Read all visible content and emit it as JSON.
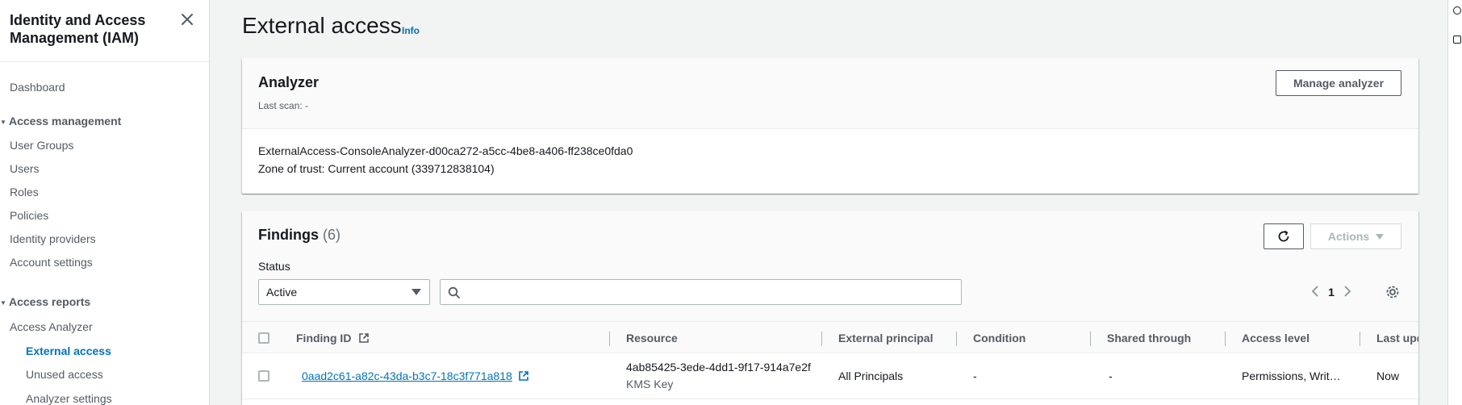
{
  "sidebar": {
    "title": "Identity and Access Management (IAM)",
    "dashboard": "Dashboard",
    "access_management": {
      "label": "Access management",
      "items": [
        "User Groups",
        "Users",
        "Roles",
        "Policies",
        "Identity providers",
        "Account settings"
      ]
    },
    "access_reports": {
      "label": "Access reports",
      "analyzer": "Access Analyzer",
      "sub_items": [
        "External access",
        "Unused access",
        "Analyzer settings"
      ]
    }
  },
  "page": {
    "title": "External access",
    "info": "Info"
  },
  "analyzer": {
    "title": "Analyzer",
    "last_scan": "Last scan: -",
    "manage_button": "Manage analyzer",
    "name": "ExternalAccess-ConsoleAnalyzer-d00ca272-a5cc-4be8-a406-ff238ce0fda0",
    "zone_of_trust": "Zone of trust: Current account (339712838104)"
  },
  "findings": {
    "title": "Findings",
    "count": "(6)",
    "actions_button": "Actions",
    "status_label": "Status",
    "status_value": "Active",
    "search_placeholder": "",
    "page_number": "1",
    "columns": {
      "finding_id": "Finding ID",
      "resource": "Resource",
      "external_principal": "External principal",
      "condition": "Condition",
      "shared_through": "Shared through",
      "access_level": "Access level",
      "last_updated": "Last upd"
    },
    "rows": [
      {
        "finding_id": "0aad2c61-a82c-43da-b3c7-18c3f771a818",
        "resource_id": "4ab85425-3ede-4dd1-9f17-914a7e2f",
        "resource_type": "KMS Key",
        "external_principal": "All Principals",
        "condition": "-",
        "shared_through": "-",
        "access_level": "Permissions, Writ…",
        "last_updated": "Now"
      }
    ]
  },
  "colors": {
    "link": "#0073bb",
    "text": "#16191f",
    "muted": "#545b64",
    "background": "#f2f3f3"
  }
}
